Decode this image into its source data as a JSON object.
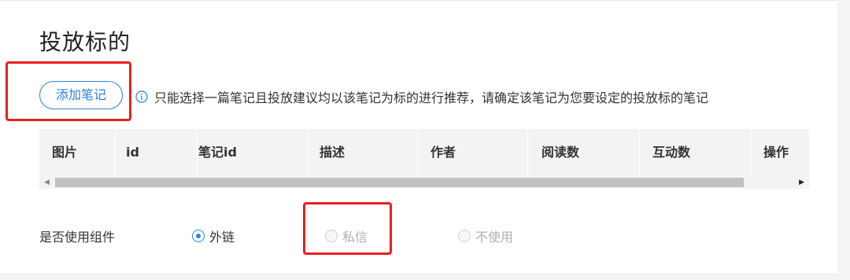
{
  "section": {
    "title": "投放标的"
  },
  "add_button": {
    "label": "添加笔记"
  },
  "tip": {
    "text": "只能选择一篇笔记且投放建议均以该笔记为标的进行推荐，请确定该笔记为您要设定的投放标的笔记"
  },
  "table": {
    "headers": [
      "图片",
      "id",
      "笔记id",
      "描述",
      "作者",
      "阅读数",
      "互动数",
      "操作"
    ],
    "rows": []
  },
  "scrollbar": {
    "left_arrow": "◀",
    "right_arrow": "▶"
  },
  "component": {
    "label": "是否使用组件",
    "options": [
      {
        "label": "外链",
        "selected": true,
        "enabled": true
      },
      {
        "label": "私信",
        "selected": false,
        "enabled": false
      },
      {
        "label": "不使用",
        "selected": false,
        "enabled": false
      }
    ]
  },
  "colors": {
    "accent": "#2a82e4",
    "highlight": "#e8201d",
    "disabled_text": "#b0b0b0"
  },
  "icons": {
    "tip": "info-circle-icon"
  }
}
